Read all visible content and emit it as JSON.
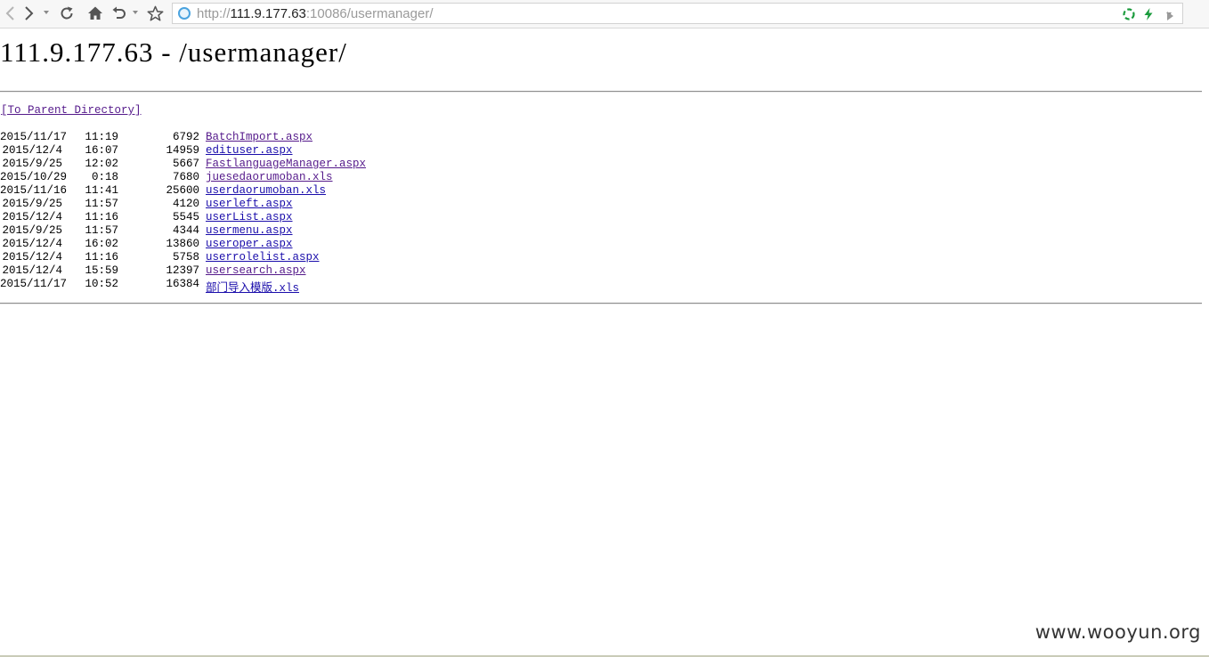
{
  "browser": {
    "address": {
      "protocol": "http://",
      "host": "111.9.177.63",
      "rest": ":10086/usermanager/"
    },
    "icons": {
      "back": "back-icon",
      "forward": "forward-icon",
      "refresh": "refresh-icon",
      "home": "home-icon",
      "undo": "undo-icon",
      "favorite": "star-icon",
      "site": "globe-icon",
      "extension": "recycle-icon",
      "speed": "lightning-icon"
    },
    "accent": "#1a9b3c"
  },
  "page": {
    "heading": "111.9.177.63 - /usermanager/",
    "parent_link": "[To Parent Directory]",
    "files": [
      {
        "date": "2015/11/17",
        "time": "11:19",
        "size": "6792",
        "name": "BatchImport.aspx",
        "visited": true
      },
      {
        "date": "2015/12/4",
        "time": "16:07",
        "size": "14959",
        "name": "edituser.aspx",
        "visited": false
      },
      {
        "date": "2015/9/25",
        "time": "12:02",
        "size": "5667",
        "name": "FastlanguageManager.aspx",
        "visited": true
      },
      {
        "date": "2015/10/29",
        "time": "0:18",
        "size": "7680",
        "name": "juesedaorumoban.xls",
        "visited": true
      },
      {
        "date": "2015/11/16",
        "time": "11:41",
        "size": "25600",
        "name": "userdaorumoban.xls",
        "visited": false
      },
      {
        "date": "2015/9/25",
        "time": "11:57",
        "size": "4120",
        "name": "userleft.aspx",
        "visited": false
      },
      {
        "date": "2015/12/4",
        "time": "11:16",
        "size": "5545",
        "name": "userList.aspx",
        "visited": false
      },
      {
        "date": "2015/9/25",
        "time": "11:57",
        "size": "4344",
        "name": "usermenu.aspx",
        "visited": false
      },
      {
        "date": "2015/12/4",
        "time": "16:02",
        "size": "13860",
        "name": "useroper.aspx",
        "visited": false
      },
      {
        "date": "2015/12/4",
        "time": "11:16",
        "size": "5758",
        "name": "userrolelist.aspx",
        "visited": false
      },
      {
        "date": "2015/12/4",
        "time": "15:59",
        "size": "12397",
        "name": "usersearch.aspx",
        "visited": true
      },
      {
        "date": "2015/11/17",
        "time": "10:52",
        "size": "16384",
        "name": "部门导入模版.xls",
        "visited": false
      }
    ]
  },
  "watermark": "www.wooyun.org"
}
